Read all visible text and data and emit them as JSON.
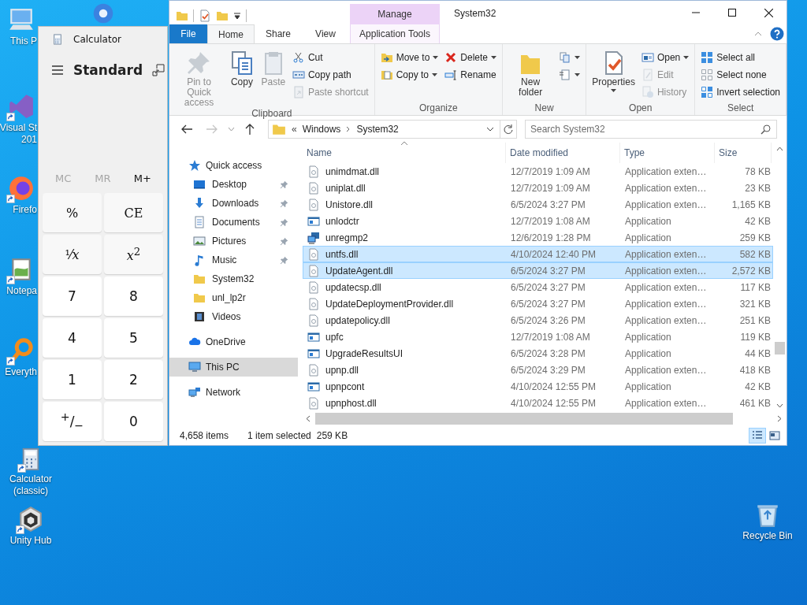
{
  "desktop": {
    "icons": [
      {
        "lines": [
          "This P"
        ],
        "kind": "computer",
        "shortcut": false
      },
      {
        "kind": "browser",
        "shortcut": false
      },
      {
        "lines": [
          "Visual St",
          "201"
        ],
        "kind": "visual-studio",
        "shortcut": true
      },
      {
        "lines": [
          "Firefo"
        ],
        "kind": "firefox",
        "shortcut": true
      },
      {
        "lines": [
          "Notepa"
        ],
        "kind": "notepad",
        "shortcut": true
      },
      {
        "lines": [
          "Everyth"
        ],
        "kind": "search-app",
        "shortcut": true
      },
      {
        "lines": [
          "Calculator",
          "(classic)"
        ],
        "kind": "calculator",
        "shortcut": true
      },
      {
        "lines": [
          "Unity Hub"
        ],
        "kind": "cube",
        "shortcut": true
      },
      {
        "lines": [
          "Recycle Bin"
        ],
        "kind": "recycle-bin",
        "shortcut": false
      }
    ]
  },
  "calculator": {
    "title": "Calculator",
    "mode": "Standard",
    "memory": [
      {
        "label": "MC",
        "disabled": true
      },
      {
        "label": "MR",
        "disabled": true
      },
      {
        "label": "M+",
        "disabled": false
      }
    ],
    "keys": [
      {
        "label": "%",
        "kind": "function"
      },
      {
        "label": "CE",
        "kind": "function"
      },
      {
        "label": "¹⁄*x*",
        "kind": "function"
      },
      {
        "label": "*x*$^{2}$",
        "kind": "function"
      },
      {
        "label": "7",
        "kind": "number"
      },
      {
        "label": "8",
        "kind": "number"
      },
      {
        "label": "4",
        "kind": "number"
      },
      {
        "label": "5",
        "kind": "number"
      },
      {
        "label": "1",
        "kind": "number"
      },
      {
        "label": "2",
        "kind": "number"
      },
      {
        "label": "$^{+}$/$_{−}$",
        "kind": "number"
      },
      {
        "label": "0",
        "kind": "number"
      }
    ]
  },
  "explorer": {
    "title": "System32",
    "context_group": "Manage",
    "tabs": [
      {
        "label": "File",
        "kind": "file",
        "selected": false
      },
      {
        "label": "Home",
        "kind": "normal",
        "selected": true
      },
      {
        "label": "Share",
        "kind": "normal",
        "selected": false
      },
      {
        "label": "View",
        "kind": "normal",
        "selected": false
      },
      {
        "label": "Application Tools",
        "kind": "context",
        "selected": false
      }
    ],
    "ribbon": [
      {
        "name": "Clipboard",
        "items": [
          {
            "kind": "pin",
            "label": "Pin to Quick access",
            "disabled": true,
            "dropdown": false
          },
          {
            "kind": "copy",
            "label": "Copy",
            "disabled": false,
            "dropdown": false
          },
          {
            "kind": "paste",
            "label": "Paste",
            "disabled": true,
            "dropdown": false
          },
          {
            "items": [
              {
                "label": "Cut",
                "kind": "scissors",
                "disabled": false,
                "dropdown": false
              },
              {
                "label": "Copy path",
                "kind": "copy-path",
                "disabled": false,
                "dropdown": false
              },
              {
                "label": "Paste shortcut",
                "kind": "paste-shortcut",
                "disabled": true,
                "dropdown": false
              }
            ]
          }
        ]
      },
      {
        "name": "Organize",
        "items": [
          {
            "items": [
              {
                "label": "Move to",
                "kind": "move-to",
                "disabled": false,
                "dropdown": true
              },
              {
                "label": "Copy to",
                "kind": "copy-to",
                "disabled": false,
                "dropdown": true
              }
            ]
          },
          {
            "items": [
              {
                "label": "Delete",
                "kind": "delete",
                "disabled": false,
                "dropdown": true
              },
              {
                "label": "Rename",
                "kind": "rename",
                "disabled": false,
                "dropdown": false
              }
            ]
          }
        ]
      },
      {
        "name": "New",
        "items": [
          {
            "kind": "new-folder",
            "label": "New folder",
            "disabled": false,
            "dropdown": false
          },
          {
            "items": [
              {
                "kind": "new-item",
                "disabled": false,
                "dropdown": true
              },
              {
                "kind": "easy-access",
                "disabled": false,
                "dropdown": true
              }
            ]
          }
        ]
      },
      {
        "name": "Open",
        "items": [
          {
            "kind": "properties",
            "label": "Properties",
            "disabled": false,
            "dropdown": true
          },
          {
            "items": [
              {
                "label": "Open",
                "kind": "open",
                "disabled": false,
                "dropdown": true
              },
              {
                "label": "Edit",
                "kind": "edit",
                "disabled": true,
                "dropdown": false
              },
              {
                "label": "History",
                "kind": "history",
                "disabled": true,
                "dropdown": false
              }
            ]
          }
        ]
      },
      {
        "name": "Select",
        "items": [
          {
            "items": [
              {
                "label": "Select all",
                "kind": "select-all",
                "disabled": false,
                "dropdown": false
              },
              {
                "label": "Select none",
                "kind": "select-none",
                "disabled": false,
                "dropdown": false
              },
              {
                "label": "Invert selection",
                "kind": "invert-selection",
                "disabled": false,
                "dropdown": false
              }
            ]
          }
        ]
      }
    ],
    "address": {
      "overflow_mark": "«",
      "crumbs": [
        "Windows",
        "System32"
      ]
    },
    "search": {
      "placeholder": "Search System32"
    },
    "nav": [
      {
        "label": "Quick access",
        "kind": "star",
        "selected": false,
        "pinned": false,
        "children": [
          {
            "label": "Desktop",
            "kind": "desktop",
            "selected": false,
            "pinned": true
          },
          {
            "label": "Downloads",
            "kind": "download",
            "selected": false,
            "pinned": true
          },
          {
            "label": "Documents",
            "kind": "document",
            "selected": false,
            "pinned": true
          },
          {
            "label": "Pictures",
            "kind": "picture",
            "selected": false,
            "pinned": true
          },
          {
            "label": "Music",
            "kind": "music",
            "selected": false,
            "pinned": true
          },
          {
            "label": "System32",
            "kind": "folder",
            "selected": false,
            "pinned": false
          },
          {
            "label": "unl_lp2r",
            "kind": "folder",
            "selected": false,
            "pinned": false
          },
          {
            "label": "Videos",
            "kind": "video",
            "selected": false,
            "pinned": false
          }
        ]
      },
      {
        "label": "OneDrive",
        "kind": "cloud",
        "selected": false,
        "pinned": false
      },
      {
        "label": "This PC",
        "kind": "pc",
        "selected": true,
        "pinned": false
      },
      {
        "label": "Network",
        "kind": "network",
        "selected": false,
        "pinned": false
      }
    ],
    "columns": [
      {
        "label": "Name",
        "sorted": true
      },
      {
        "label": "Date modified",
        "sorted": false
      },
      {
        "label": "Type",
        "sorted": false
      },
      {
        "label": "Size",
        "sorted": false
      }
    ],
    "rows": [
      {
        "name": "unimdmat.dll",
        "date": "12/7/2019 1:09 AM",
        "type": "Application exten…",
        "size": "78 KB",
        "kind": "dll",
        "highlighted": false
      },
      {
        "name": "uniplat.dll",
        "date": "12/7/2019 1:09 AM",
        "type": "Application exten…",
        "size": "23 KB",
        "kind": "dll",
        "highlighted": false
      },
      {
        "name": "Unistore.dll",
        "date": "6/5/2024 3:27 PM",
        "type": "Application exten…",
        "size": "1,165 KB",
        "kind": "dll",
        "highlighted": false
      },
      {
        "name": "unlodctr",
        "date": "12/7/2019 1:08 AM",
        "type": "Application",
        "size": "42 KB",
        "kind": "app",
        "highlighted": false
      },
      {
        "name": "unregmp2",
        "date": "12/6/2019 1:28 PM",
        "type": "Application",
        "size": "259 KB",
        "kind": "setup",
        "highlighted": false
      },
      {
        "name": "untfs.dll",
        "date": "4/10/2024 12:40 PM",
        "type": "Application exten…",
        "size": "582 KB",
        "kind": "dll",
        "highlighted": true
      },
      {
        "name": "UpdateAgent.dll",
        "date": "6/5/2024 3:27 PM",
        "type": "Application exten…",
        "size": "2,572 KB",
        "kind": "dll",
        "highlighted": true
      },
      {
        "name": "updatecsp.dll",
        "date": "6/5/2024 3:27 PM",
        "type": "Application exten…",
        "size": "117 KB",
        "kind": "dll",
        "highlighted": false
      },
      {
        "name": "UpdateDeploymentProvider.dll",
        "date": "6/5/2024 3:27 PM",
        "type": "Application exten…",
        "size": "321 KB",
        "kind": "dll",
        "highlighted": false
      },
      {
        "name": "updatepolicy.dll",
        "date": "6/5/2024 3:26 PM",
        "type": "Application exten…",
        "size": "251 KB",
        "kind": "dll",
        "highlighted": false
      },
      {
        "name": "upfc",
        "date": "12/7/2019 1:08 AM",
        "type": "Application",
        "size": "119 KB",
        "kind": "app",
        "highlighted": false
      },
      {
        "name": "UpgradeResultsUI",
        "date": "6/5/2024 3:28 PM",
        "type": "Application",
        "size": "44 KB",
        "kind": "app",
        "highlighted": false
      },
      {
        "name": "upnp.dll",
        "date": "6/5/2024 3:29 PM",
        "type": "Application exten…",
        "size": "418 KB",
        "kind": "dll",
        "highlighted": false
      },
      {
        "name": "upnpcont",
        "date": "4/10/2024 12:55 PM",
        "type": "Application",
        "size": "42 KB",
        "kind": "app",
        "highlighted": false
      },
      {
        "name": "upnphost.dll",
        "date": "4/10/2024 12:55 PM",
        "type": "Application exten…",
        "size": "461 KB",
        "kind": "dll",
        "highlighted": false
      }
    ],
    "status": {
      "items": "4,658 items",
      "selection": "1 item selected",
      "size": "259 KB"
    },
    "views": [
      {
        "kind": "details",
        "selected": true
      },
      {
        "kind": "tiles",
        "selected": false
      }
    ]
  }
}
